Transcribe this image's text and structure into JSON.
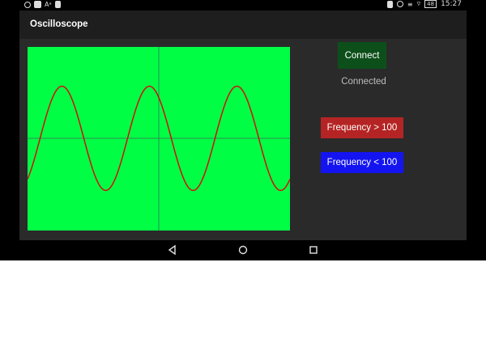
{
  "status_bar": {
    "time": "15:27",
    "battery": "48",
    "left_icons": [
      "whatsapp-icon",
      "app-icon",
      "font-icon",
      "clipboard-icon"
    ],
    "right_icons": [
      "sim-icon",
      "alarm-icon",
      "vibrate-icon",
      "wifi-icon",
      "battery-icon"
    ]
  },
  "app": {
    "title": "Oscilloscope"
  },
  "scope": {
    "background": "#00ff44",
    "grid_color": "#2e8b57",
    "trace_color": "#d01010",
    "signal": {
      "type": "sine",
      "cycles_visible": 3,
      "amplitude_fraction": 0.55,
      "phase": "starts near center going up"
    }
  },
  "controls": {
    "connect_label": "Connect",
    "connect_color": "#0d4f1a",
    "connection_status": "Connected",
    "freq_up_label": "Frequency > 100",
    "freq_up_color": "#b52424",
    "freq_down_label": "Frequency < 100",
    "freq_down_color": "#1414f0"
  },
  "navigation": {
    "buttons": [
      "back-icon",
      "home-icon",
      "recents-icon"
    ]
  }
}
